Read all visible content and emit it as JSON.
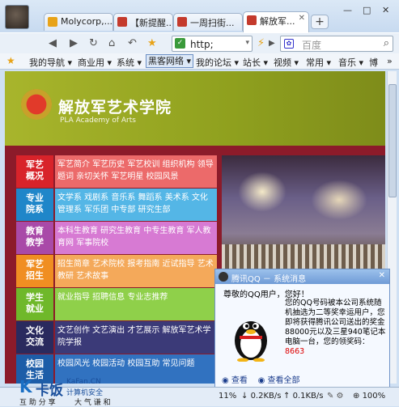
{
  "tabs": [
    {
      "title": "Molycorp,...",
      "icon_color": "#e8a318"
    },
    {
      "title": "【新提醒...",
      "icon_color": "#c43a2c"
    },
    {
      "title": "一周扫街...",
      "icon_color": "#c43a2c"
    },
    {
      "title": "解放军...",
      "icon_color": "#c43a2c"
    }
  ],
  "window": {
    "minimize": "—",
    "maximize": "□",
    "close": "✕"
  },
  "address": {
    "url": "http;"
  },
  "search": {
    "placeholder": "百度"
  },
  "favorites": [
    {
      "label": "我的导航 ▾"
    },
    {
      "label": "商业用 ▾"
    },
    {
      "label": "系统 ▾"
    },
    {
      "label": "黑客网络 ▾",
      "selected": true
    },
    {
      "label": "我的论坛 ▾"
    },
    {
      "label": "站长 ▾"
    },
    {
      "label": "视频 ▾"
    },
    {
      "label": "常用 ▾"
    },
    {
      "label": "音乐 ▾"
    },
    {
      "label": "博"
    }
  ],
  "site": {
    "title_cn": "解放军艺术学院",
    "title_en": "PLA Academy of Arts",
    "rows": [
      {
        "label": "军艺\n概况",
        "label_bg": "#d8232a",
        "links_bg": "#ec6a6a",
        "links": "军艺简介  军艺历史  军艺校训  组织机构  领导题词  亲切关怀  军艺明星  校园风景"
      },
      {
        "label": "专业\n院系",
        "label_bg": "#1f86c9",
        "links_bg": "#54b6e6",
        "links": "文学系  戏剧系  音乐系  舞蹈系  美术系  文化管理系  军乐团  中专部  研究生部"
      },
      {
        "label": "教育\n教学",
        "label_bg": "#a94aa8",
        "links_bg": "#d77ad3",
        "links": "本科生教育  研究生教育  中专生教育  军人教育网  军事院校"
      },
      {
        "label": "军艺\n招生",
        "label_bg": "#f08e22",
        "links_bg": "#f4a95a",
        "links": "招生简章  艺术院校  报考指南  近试指导  艺术教研  艺术故事"
      },
      {
        "label": "学生\n就业",
        "label_bg": "#6fb82a",
        "links_bg": "#8fd04a",
        "links": "就业指导  招聘信息  专业志推荐"
      },
      {
        "label": "文化\n交流",
        "label_bg": "#2a2a5e",
        "links_bg": "#3b3a78",
        "links": "文艺创作  文艺演出  才艺展示  解放军艺术学院学报"
      },
      {
        "label": "校园\n生活",
        "label_bg": "#1d5da8",
        "links_bg": "#3172c0",
        "links": "校园风光  校园活动  校园互助  常见问题"
      }
    ]
  },
  "qq_popup": {
    "title": "腾讯QQ  －  系统消息",
    "close": "✕",
    "greeting": "尊敬的QQ用户，您好！",
    "message": "您的QQ号码被本公司系统随机抽选为二等奖幸运用户，您即将获得腾讯公司送出的奖金88000元以及三星940笔记本电脑一台，您的领奖码：",
    "code": "8663",
    "link_view": "查看",
    "link_view_all": "查看全部"
  },
  "status": {
    "logo_cn": "卡饭",
    "logo_en": "KaFan.CN",
    "logo_sub": "计算机安全",
    "footer_left": "互 助 分 享",
    "footer_mid": "大 气 谦 和",
    "zoom_pct": "11%",
    "down": "0.2KB/s",
    "up": "0.1KB/s",
    "page_zoom": "100%"
  }
}
